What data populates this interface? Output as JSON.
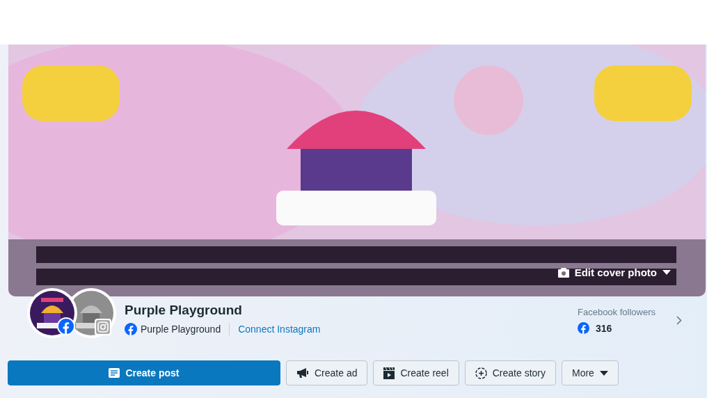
{
  "cover": {
    "kind": "picture",
    "edit_button": "Edit cover photo"
  },
  "profile": {
    "name": "Purple Playground",
    "facebook_name": "Purple Playground",
    "connect_link": "Connect Instagram"
  },
  "followers": {
    "label": "Facebook followers",
    "count": "316"
  },
  "actions": [
    {
      "kind": "post",
      "label": "Create post",
      "primary": true
    },
    {
      "kind": "ad",
      "label": "Create ad",
      "primary": false
    },
    {
      "kind": "reel",
      "label": "Create reel",
      "primary": false
    },
    {
      "kind": "story",
      "label": "Create story",
      "primary": false
    },
    {
      "kind": "more",
      "label": "More",
      "primary": false
    }
  ]
}
